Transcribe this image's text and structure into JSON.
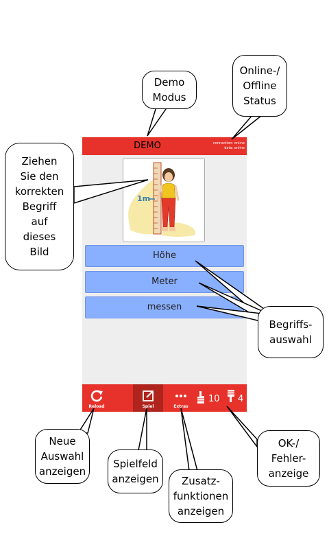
{
  "annotations": {
    "demo_modus": "Demo\nModus",
    "online_status": "Online-/\nOffline\nStatus",
    "ziehen": "Ziehen\nSie den\nkorrekten\nBegriff\nauf\ndieses\nBild",
    "begriffsauswahl": "Begriffs-\nauswahl",
    "neue_auswahl": "Neue\nAuswahl\nanzeigen",
    "spielfeld": "Spielfeld\nanzeigen",
    "zusatz": "Zusatz-\nfunktionen\nanzeigen",
    "ok_fehler": "OK-/\nFehler-\nanzeige"
  },
  "app": {
    "title": "DEMO",
    "connection_status": "connection: online",
    "data_status": "data: online",
    "image_label": "1m",
    "terms": [
      "Höhe",
      "Meter",
      "messen"
    ],
    "nav": {
      "reload": "Reload",
      "spiel": "Spiel",
      "extras": "Extras"
    },
    "ok_count": "10",
    "error_count": "4",
    "colors": {
      "bar": "#e6322b",
      "term_button": "#89afff",
      "background": "#eeeeee"
    },
    "icons": {
      "reload": "reload-icon",
      "spiel": "edit-icon",
      "extras": "more-dots-icon",
      "ok": "thumbs-up-icon",
      "error": "thumbs-down-icon"
    }
  }
}
